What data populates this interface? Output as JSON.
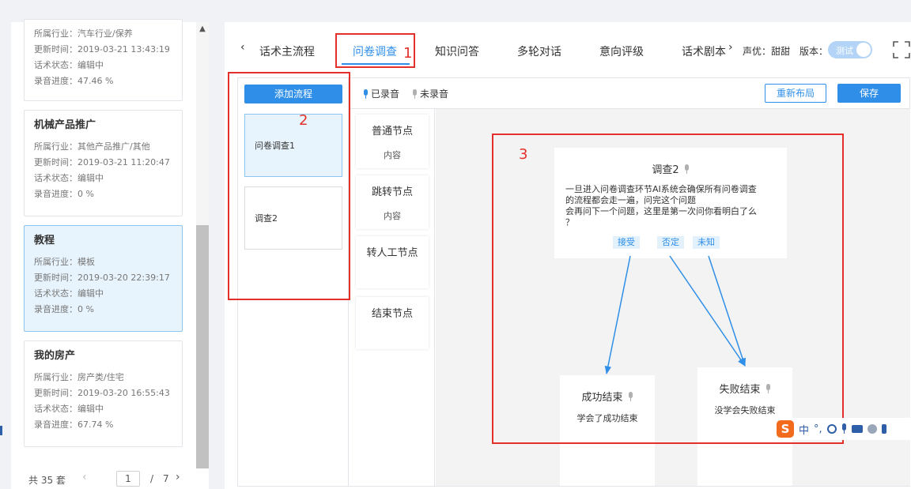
{
  "cards": [
    {
      "title": "",
      "industry": "所属行业：汽车行业/保养",
      "updated": "更新时间：2019-03-21 13:43:19",
      "status": "话术状态：编辑中",
      "progress": "录音进度：47.46 %"
    },
    {
      "title": "机械产品推广",
      "industry": "所属行业：其他产品推广/其他",
      "updated": "更新时间：2019-03-21 11:20:47",
      "status": "话术状态：编辑中",
      "progress": "录音进度：0 %"
    },
    {
      "title": "教程",
      "industry": "所属行业：模板",
      "updated": "更新时间：2019-03-20 22:39:17",
      "status": "话术状态：编辑中",
      "progress": "录音进度：0 %"
    },
    {
      "title": "我的房产",
      "industry": "所属行业：房产类/住宅",
      "updated": "更新时间：2019-03-20 16:55:43",
      "status": "话术状态：编辑中",
      "progress": "录音进度：67.74 %"
    }
  ],
  "pager": {
    "total": "共 35 套",
    "prev": "‹",
    "current": "1",
    "sep": "/",
    "pages": "7",
    "next": "›"
  },
  "tabs": {
    "back": "‹",
    "items": [
      "话术主流程",
      "问卷调查",
      "知识问答",
      "多轮对话",
      "意向评级",
      "话术剧本"
    ],
    "forward": "›",
    "voice": "声优：甜甜",
    "version_label": "版本：",
    "version_toggle": "测试"
  },
  "flows": {
    "add_label": "添加流程",
    "items": [
      "问卷调查1",
      "调查2"
    ]
  },
  "legend": {
    "recorded": "已录音",
    "unrecorded": "未录音"
  },
  "buttons": {
    "relayout": "重新布局",
    "save": "保存"
  },
  "palette": [
    {
      "title": "普通节点",
      "sub": "内容"
    },
    {
      "title": "跳转节点",
      "sub": "内容"
    },
    {
      "title": "转人工节点",
      "sub": ""
    },
    {
      "title": "结束节点",
      "sub": ""
    }
  ],
  "canvas": {
    "main_node": {
      "title": "调查2",
      "lines": [
        "一旦进入问卷调查环节AI系统会确保所有问卷调查",
        "的流程都会走一遍，问完这个问题",
        "会再问下一个问题，这里是第一次问你看明白了么",
        "？"
      ],
      "branches": [
        "接受",
        "否定",
        "未知"
      ]
    },
    "success_node": {
      "title": "成功结束",
      "body": "学会了成功结束"
    },
    "fail_node": {
      "title": "失败结束",
      "body": "没学会失败结束"
    }
  },
  "annotations": [
    "1",
    "2",
    "3"
  ],
  "ime": {
    "logo": "S",
    "lang": "中",
    "punct": "°,"
  },
  "colors": {
    "accent": "#2f8fe8",
    "annotation": "#e3302b",
    "active_bg": "#e8f4fd",
    "recorded_mic": "#2f8fe8",
    "unrecorded_mic": "#b0b0b0"
  }
}
